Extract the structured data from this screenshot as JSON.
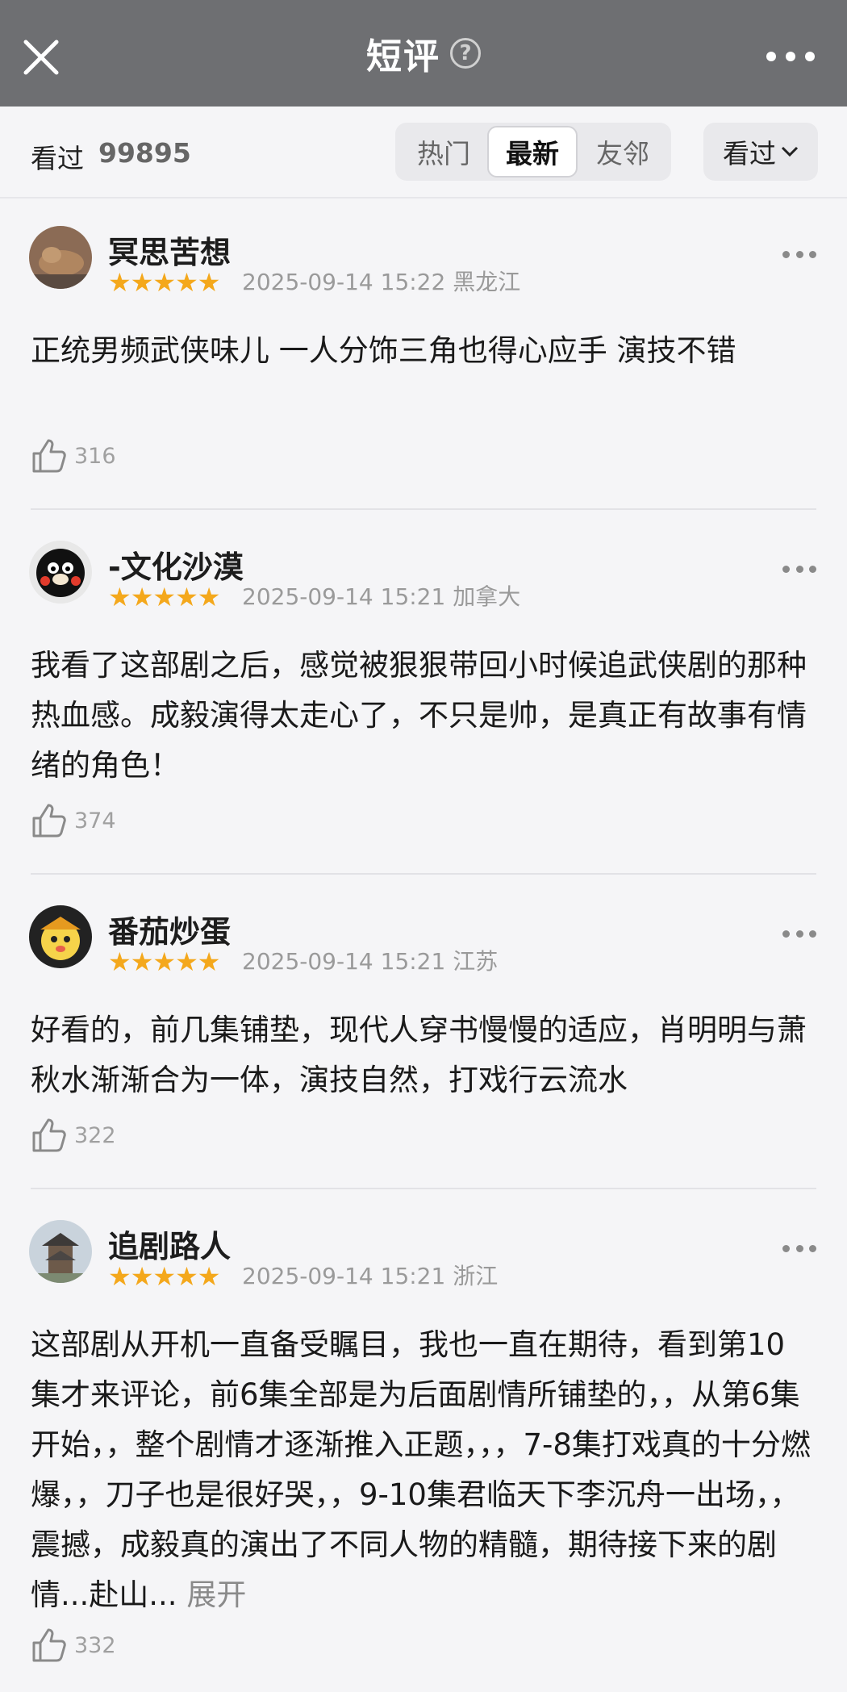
{
  "header": {
    "title": "短评",
    "help_glyph": "?"
  },
  "filter": {
    "watched_label": "看过",
    "watched_count": "99895",
    "tabs": [
      {
        "label": "热门",
        "active": false
      },
      {
        "label": "最新",
        "active": true
      },
      {
        "label": "友邻",
        "active": false
      }
    ],
    "dropdown_label": "看过"
  },
  "reviews": [
    {
      "name": "冥思苦想",
      "stars": "★★★★★",
      "rating": 5,
      "datetime": "2025-09-14 15:22",
      "location": "黑龙江",
      "text": "正统男频武侠味儿 一人分饰三角也得心应手 演技不错",
      "likes": "316",
      "avatar": "cat-photo"
    },
    {
      "name": "-文化沙漠",
      "stars": "★★★★★",
      "rating": 5,
      "datetime": "2025-09-14 15:21",
      "location": "加拿大",
      "text": "我看了这部剧之后，感觉被狠狠带回小时候追武侠剧的那种热血感。成毅演得太走心了，不只是帅，是真正有故事有情绪的角色！",
      "likes": "374",
      "avatar": "black-bear"
    },
    {
      "name": "番茄炒蛋",
      "stars": "★★★★★",
      "rating": 5,
      "datetime": "2025-09-14 15:21",
      "location": "江苏",
      "text": "好看的，前几集铺垫，现代人穿书慢慢的适应，肖明明与萧秋水渐渐合为一体，演技自然，打戏行云流水",
      "likes": "322",
      "avatar": "cartoon-kid"
    },
    {
      "name": "追剧路人",
      "stars": "★★★★★",
      "rating": 5,
      "datetime": "2025-09-14 15:21",
      "location": "浙江",
      "text": "这部剧从开机一直备受瞩目，我也一直在期待，看到第10集才来评论，前6集全部是为后面剧情所铺垫的，，从第6集开始，，整个剧情才逐渐推入正题，，，7-8集打戏真的十分燃爆，，刀子也是很好哭，，9-10集君临天下李沉舟一出场，，震撼，成毅真的演出了不同人物的精髓，期待接下来的剧情...赴山...",
      "expand_label": "展开",
      "likes": "332",
      "avatar": "pagoda-photo"
    }
  ],
  "colors": {
    "topbar": "#6e6f72",
    "star": "#f4a81c",
    "background": "#f5f5f7"
  },
  "icons": [
    "close-icon",
    "help-icon",
    "more-icon",
    "chevron-down-icon",
    "thumbs-up-icon"
  ]
}
